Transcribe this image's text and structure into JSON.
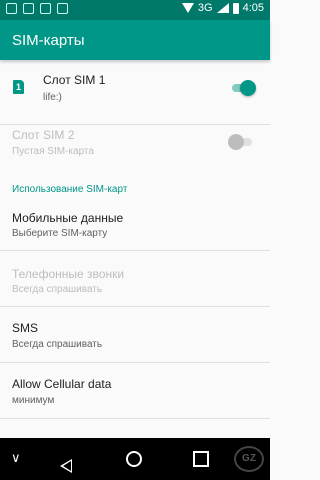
{
  "status_bar": {
    "network": "3G",
    "time": "4:05"
  },
  "appbar": {
    "title": "SIM-карты"
  },
  "sim_slots": [
    {
      "icon_text": "1",
      "title": "Слот SIM 1",
      "subtitle": "life:)",
      "enabled": true,
      "toggle_on": true
    },
    {
      "title": "Слот SIM 2",
      "subtitle": "Пустая SIM-карта",
      "enabled": false,
      "toggle_on": false
    }
  ],
  "section_header": "Использование SIM-карт",
  "settings": [
    {
      "title": "Мобильные данные",
      "subtitle": "Выберите SIM-карту",
      "enabled": true
    },
    {
      "title": "Телефонные звонки",
      "subtitle": "Всегда спрашивать",
      "enabled": false
    },
    {
      "title": "SMS",
      "subtitle": "Всегда спрашивать",
      "enabled": true
    },
    {
      "title": "Allow Cellular data",
      "subtitle": "минимум",
      "enabled": true
    }
  ],
  "nav": {
    "chevron": "∨"
  },
  "colors": {
    "primary": "#009688",
    "primary_dark": "#00796b",
    "disabled_text": "#bdbdbd"
  },
  "watermark": "GZ"
}
